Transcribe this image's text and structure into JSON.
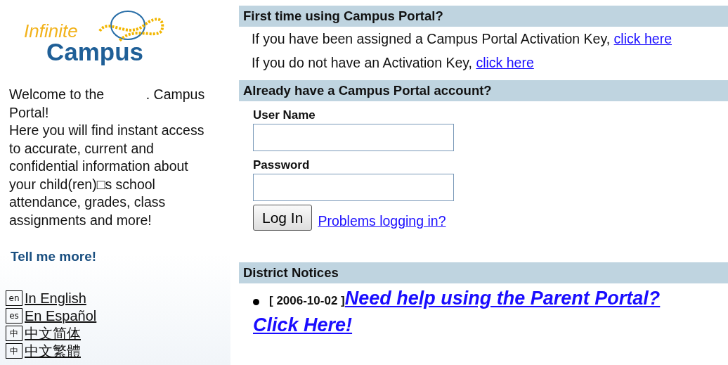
{
  "logo": {
    "word_1": "Infinite",
    "word_2": "Campus"
  },
  "welcome": {
    "line_1": "Welcome to the           . Campus Portal!",
    "line_2": "Here you will find instant access to accurate, current and confidential information about your child(ren)□s school attendance, grades, class assignments and more!"
  },
  "tell_more": "Tell me more!",
  "languages": [
    {
      "badge": "en",
      "label": "In English"
    },
    {
      "badge": "es",
      "label": "En Español"
    },
    {
      "badge": "中",
      "label": "中文简体"
    },
    {
      "badge": "中",
      "label": "中文繁體"
    }
  ],
  "first_time": {
    "heading": "First time using Campus Portal?",
    "lines": [
      {
        "text": "If you have been assigned a Campus Portal Activation Key, ",
        "link": "click here"
      },
      {
        "text": "If you do not have an Activation Key, ",
        "link": "click here"
      }
    ]
  },
  "login": {
    "heading": "Already have a Campus Portal account?",
    "fields": [
      {
        "label": "User Name"
      },
      {
        "label": "Password"
      }
    ],
    "button": "Log In",
    "help_link": "Problems logging in?"
  },
  "notices": {
    "heading": "District Notices",
    "items": [
      {
        "date": "[ 2006-10-02 ]",
        "link_lines": [
          "Need help using the Parent Portal?",
          "Click Here!"
        ]
      }
    ]
  }
}
